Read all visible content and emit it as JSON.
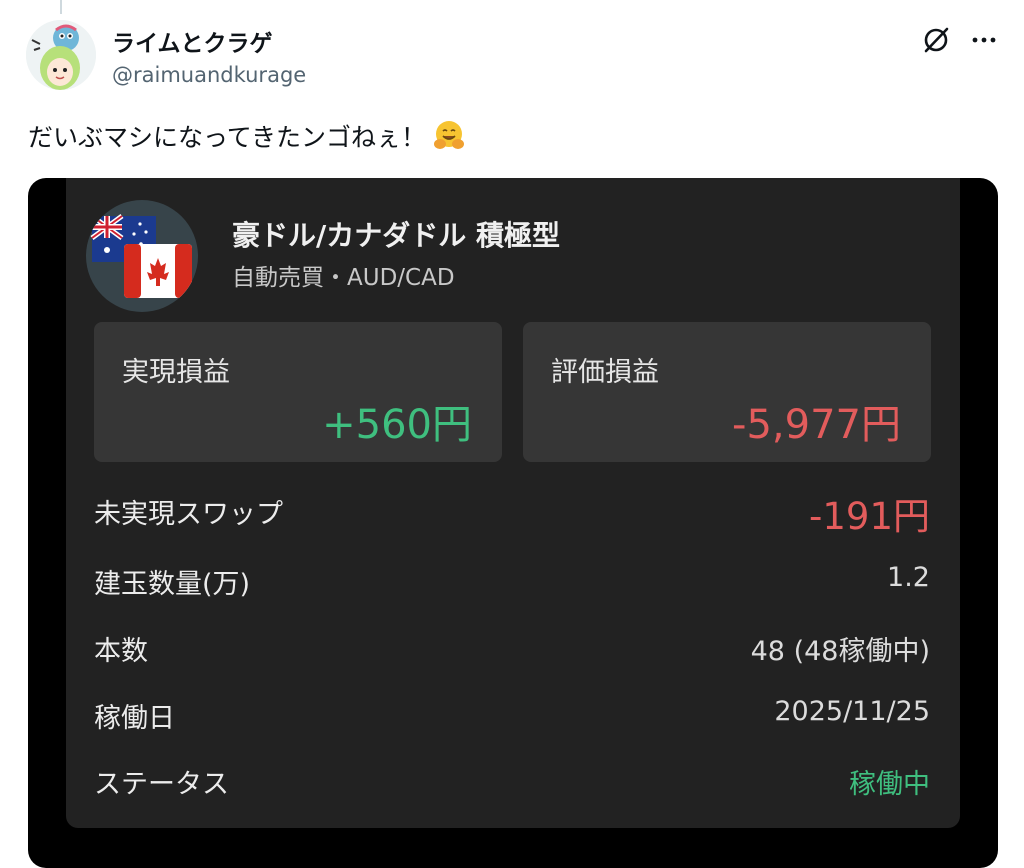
{
  "post": {
    "display_name": "ライムとクラゲ",
    "handle": "@raimuandkurage",
    "text": "だいぶマシになってきたンゴねぇ！"
  },
  "card": {
    "title": "豪ドル/カナダドル 積極型",
    "subtitle": "自動売買・AUD/CAD",
    "realized": {
      "label": "実現損益",
      "value": "+560円"
    },
    "valuation": {
      "label": "評価損益",
      "value": "-5,977円"
    },
    "rows": [
      {
        "label": "未実現スワップ",
        "value": "-191円"
      },
      {
        "label": "建玉数量(万)",
        "value": "1.2"
      },
      {
        "label": "本数",
        "value": "48 (48稼働中)"
      },
      {
        "label": "稼働日",
        "value": "2025/11/25"
      },
      {
        "label": "ステータス",
        "value": "稼働中"
      }
    ]
  },
  "colors": {
    "positive": "#3fbf7f",
    "negative": "#e25c5c",
    "card_bg": "#222222",
    "box_bg": "#363636"
  },
  "icons": [
    "avatar-image",
    "grok-icon",
    "more-icon",
    "hugging-face-emoji",
    "australia-flag-icon",
    "canada-flag-icon"
  ]
}
